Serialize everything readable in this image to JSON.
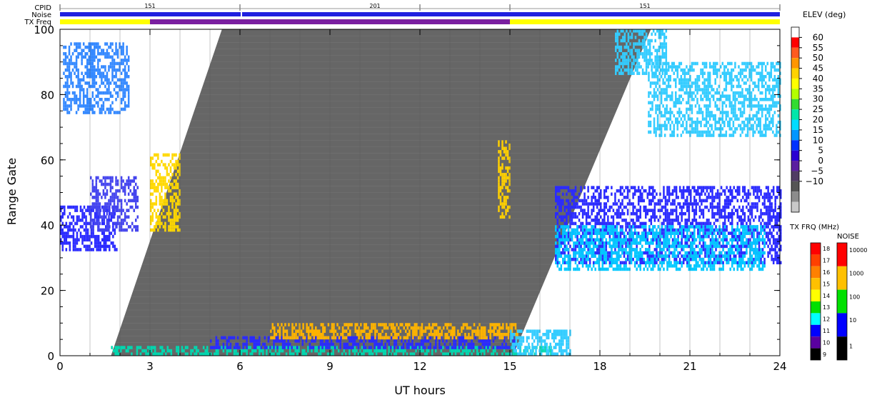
{
  "chart_data": {
    "type": "heatmap",
    "xlabel": "UT hours",
    "ylabel": "Range Gate",
    "x_ticks": [
      "0",
      "3",
      "6",
      "9",
      "12",
      "15",
      "18",
      "21",
      "24"
    ],
    "y_ticks": [
      "0",
      "20",
      "40",
      "60",
      "80",
      "100"
    ],
    "xlim": [
      0,
      24
    ],
    "ylim": [
      0,
      100
    ],
    "top_strip": {
      "row_labels": [
        "CPID",
        "Noise",
        "TX Freq"
      ],
      "cpid_segments": [
        {
          "start": 0,
          "end": 6,
          "label": "151"
        },
        {
          "start": 6,
          "end": 15,
          "label": "201"
        },
        {
          "start": 15,
          "end": 24,
          "label": "151"
        }
      ],
      "noise_color": "#2020e0",
      "tx_freq_segments": [
        {
          "start": 0,
          "end": 3,
          "color": "#ffff00"
        },
        {
          "start": 3,
          "end": 15,
          "color": "#7a1fa0"
        },
        {
          "start": 15,
          "end": 24,
          "color": "#ffff00"
        }
      ]
    },
    "ground_scatter_region": {
      "color": "#666666",
      "polygon_ut_gate": [
        [
          1.7,
          0
        ],
        [
          5.4,
          100
        ],
        [
          19.7,
          100
        ],
        [
          15.1,
          0
        ]
      ]
    },
    "elevation_colorbar": {
      "title": "ELEV (deg)",
      "labels": [
        "60",
        "55",
        "50",
        "45",
        "40",
        "35",
        "30",
        "25",
        "20",
        "15",
        "10",
        "5",
        "0",
        "−5",
        "−10"
      ],
      "colors": [
        "#ffffff",
        "#ff0000",
        "#ff5a1e",
        "#ff9600",
        "#ffd200",
        "#ffff00",
        "#b4ff00",
        "#32dc32",
        "#00e6aa",
        "#00dcff",
        "#0096ff",
        "#0032ff",
        "#2a00d2",
        "#5a1ea0",
        "#503c64",
        "#555555",
        "#8c8c8c",
        "#c8c8c8"
      ]
    },
    "txfreq_colorbar": {
      "title": "TX FRQ (MHz)",
      "labels": [
        "18",
        "17",
        "16",
        "15",
        "14",
        "13",
        "12",
        "11",
        "10",
        "9"
      ],
      "colors": [
        "#ff0000",
        "#ff4000",
        "#ff8000",
        "#ffc000",
        "#ffff00",
        "#00e000",
        "#00ffff",
        "#0000ff",
        "#5a00a0",
        "#000000"
      ]
    },
    "noise_colorbar": {
      "title": "NOISE",
      "labels": [
        "10000",
        "1000",
        "100",
        "10",
        "1"
      ],
      "colors": [
        "#ff0000",
        "#ffc000",
        "#00e000",
        "#0000ff",
        "#000000"
      ]
    },
    "echo_regions": [
      {
        "ut": [
          0.0,
          1.9
        ],
        "gate": [
          32,
          46
        ],
        "color": "#2a2aff"
      },
      {
        "ut": [
          1.0,
          2.6
        ],
        "gate": [
          38,
          55
        ],
        "color": "#4444ee"
      },
      {
        "ut": [
          0.1,
          2.3
        ],
        "gate": [
          74,
          96
        ],
        "color": "#3388ff"
      },
      {
        "ut": [
          3.0,
          4.0
        ],
        "gate": [
          38,
          62
        ],
        "color": "#ffd800"
      },
      {
        "ut": [
          16.5,
          24.0
        ],
        "gate": [
          28,
          52
        ],
        "color": "#2a2aff"
      },
      {
        "ut": [
          16.5,
          23.5
        ],
        "gate": [
          26,
          40
        ],
        "color": "#00c8ff"
      },
      {
        "ut": [
          19.6,
          24.0
        ],
        "gate": [
          67,
          90
        ],
        "color": "#33ccff"
      },
      {
        "ut": [
          18.5,
          20.2
        ],
        "gate": [
          86,
          100
        ],
        "color": "#33ccff"
      },
      {
        "ut": [
          14.6,
          15.0
        ],
        "gate": [
          42,
          66
        ],
        "color": "#ffd000"
      },
      {
        "ut": [
          1.7,
          16.5
        ],
        "gate": [
          0,
          3
        ],
        "color": "#00d8b0"
      },
      {
        "ut": [
          5.0,
          15.3
        ],
        "gate": [
          2,
          6
        ],
        "color": "#2a2aff"
      },
      {
        "ut": [
          7.0,
          15.3
        ],
        "gate": [
          5,
          10
        ],
        "color": "#ffb400"
      },
      {
        "ut": [
          15.0,
          17.0
        ],
        "gate": [
          0,
          8
        ],
        "color": "#33ccff"
      }
    ]
  }
}
